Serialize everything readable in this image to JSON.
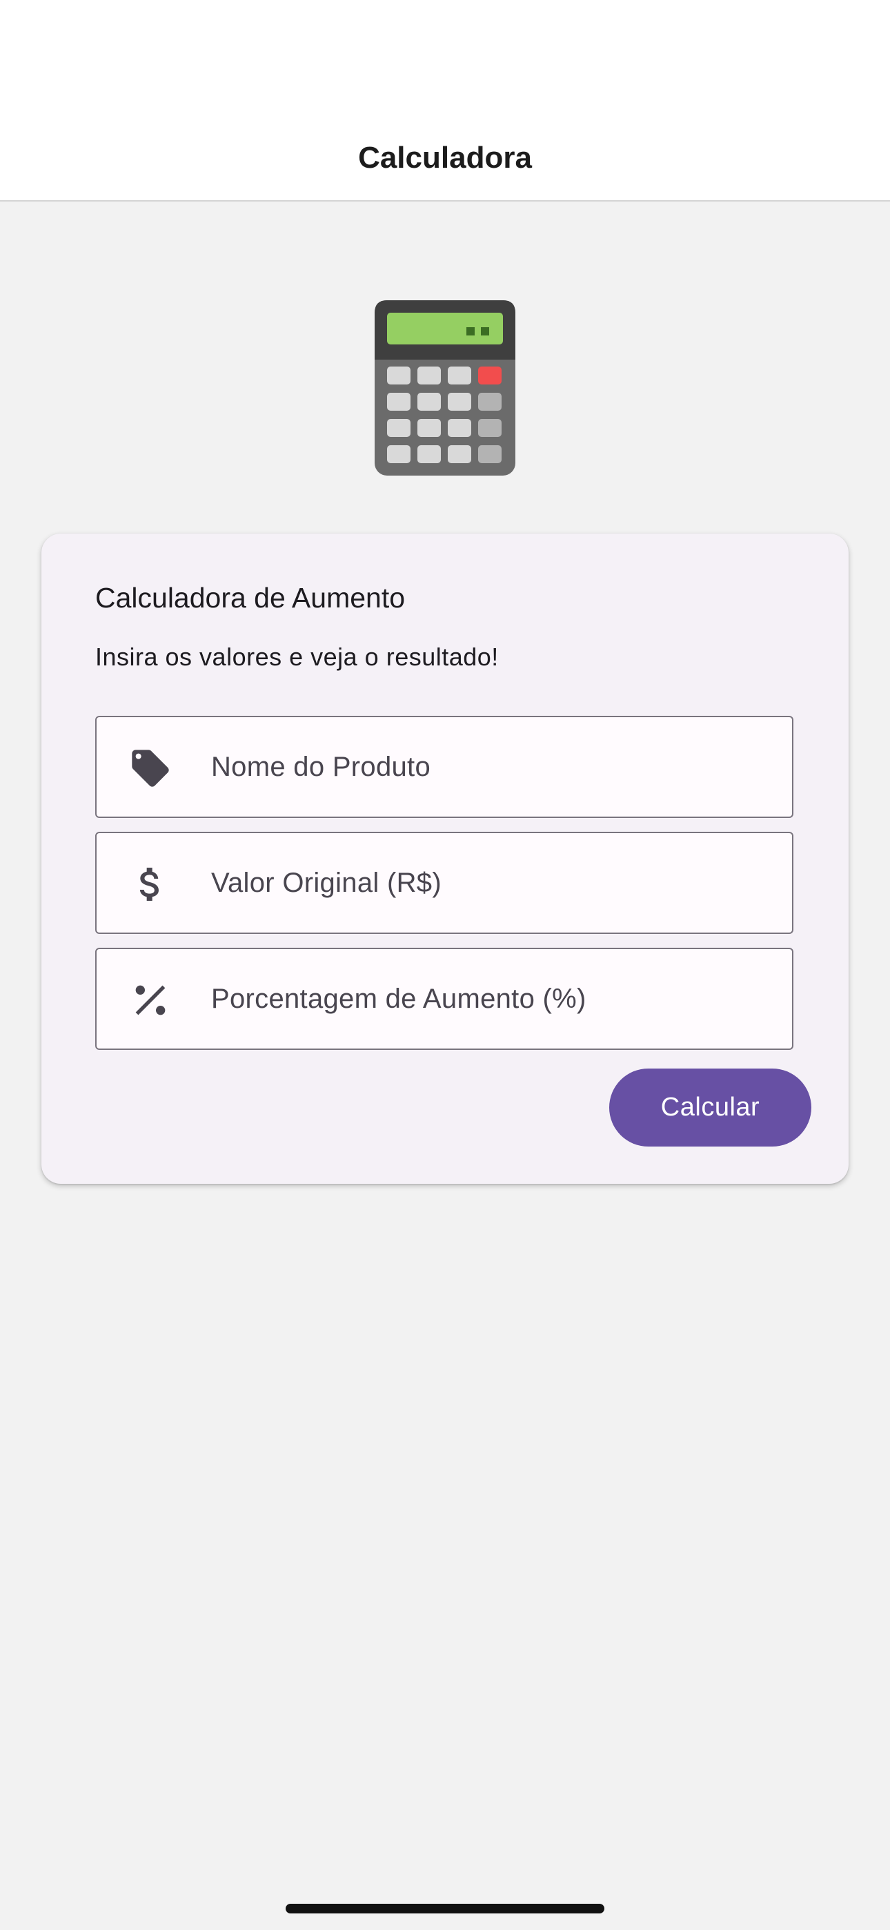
{
  "appbar": {
    "title": "Calculadora"
  },
  "hero": {
    "icon": "calculator-icon"
  },
  "card": {
    "title": "Calculadora de Aumento",
    "subtitle": "Insira os valores e veja o resultado!",
    "fields": [
      {
        "icon": "tag-icon",
        "placeholder": "Nome do Produto",
        "value": ""
      },
      {
        "icon": "dollar-icon",
        "placeholder": "Valor Original (R$)",
        "value": ""
      },
      {
        "icon": "percent-icon",
        "placeholder": "Porcentagem de Aumento (%)",
        "value": ""
      }
    ],
    "button_label": "Calcular"
  },
  "colors": {
    "primary": "#6750a4",
    "background": "#f2f2f2",
    "card": "#f5f1f7",
    "outline": "#79747e"
  }
}
